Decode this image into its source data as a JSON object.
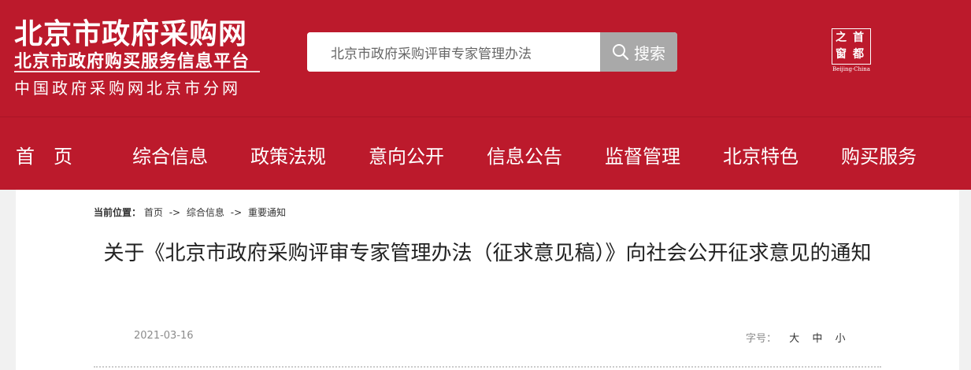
{
  "header": {
    "logo_main": "北京市政府采购网",
    "logo_sub1": "北京市政府购买服务信息平台",
    "logo_sub2": "中国政府采购网北京市分网",
    "emblem_chars": [
      "之",
      "首",
      "窗",
      "都"
    ],
    "emblem_caption": "Beijing·China"
  },
  "search": {
    "value": "北京市政府采购评审专家管理办法",
    "button_label": "搜索"
  },
  "nav": {
    "items": [
      "首　页",
      "综合信息",
      "政策法规",
      "意向公开",
      "信息公告",
      "监督管理",
      "北京特色",
      "购买服务"
    ]
  },
  "breadcrumb": {
    "label": "当前位置：",
    "items": [
      "首页",
      "综合信息",
      "重要通知"
    ],
    "separator": "->"
  },
  "article": {
    "title": "关于《北京市政府采购评审专家管理办法（征求意见稿）》向社会公开征求意见的通知",
    "date": "2021-03-16",
    "font_size_label": "字号：",
    "font_sizes": [
      "大",
      "中",
      "小"
    ]
  },
  "colors": {
    "header_red": "#bc1a2c",
    "search_button": "#a9a9a9"
  }
}
